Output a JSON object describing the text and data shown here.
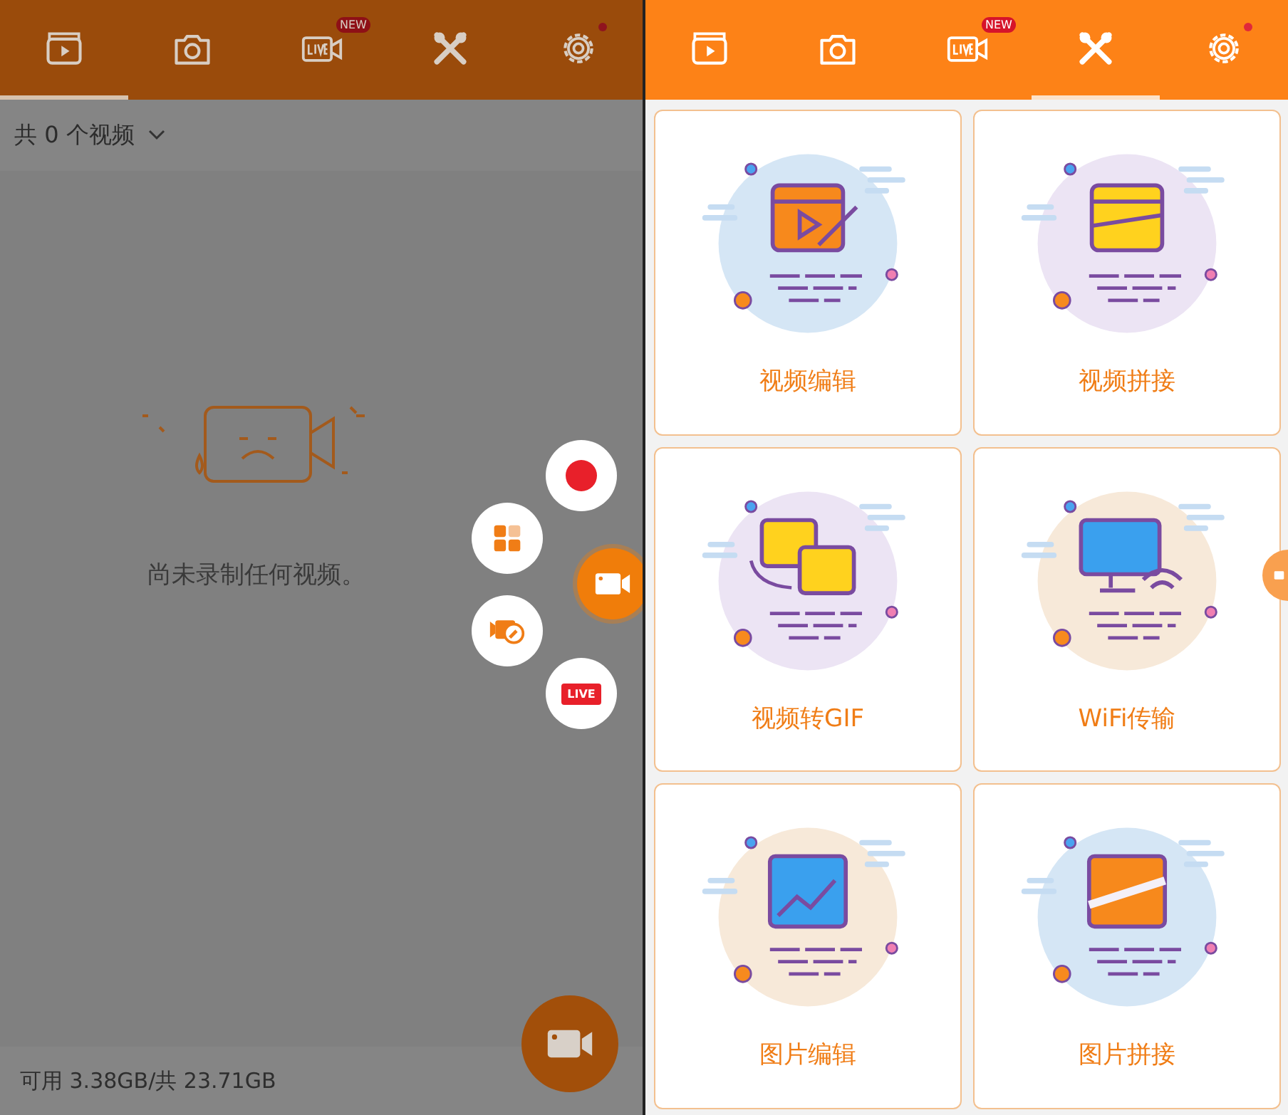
{
  "left": {
    "tabs": [
      {
        "kind": "video",
        "selected": true
      },
      {
        "kind": "camera",
        "selected": false
      },
      {
        "kind": "live",
        "selected": false,
        "badge": "NEW"
      },
      {
        "kind": "tools",
        "selected": false
      },
      {
        "kind": "settings",
        "selected": false,
        "notify": true
      }
    ],
    "video_count": "共 0 个视频",
    "empty_text": "尚未录制任何视频。",
    "fab_menu": [
      {
        "kind": "record"
      },
      {
        "kind": "apps"
      },
      {
        "kind": "camera"
      },
      {
        "kind": "tool"
      },
      {
        "kind": "live",
        "label": "LIVE"
      }
    ],
    "storage": "可用 3.38GB/共 23.71GB"
  },
  "right": {
    "tabs": [
      {
        "kind": "video",
        "selected": false
      },
      {
        "kind": "camera",
        "selected": false
      },
      {
        "kind": "live",
        "selected": false,
        "badge": "NEW"
      },
      {
        "kind": "tools",
        "selected": true
      },
      {
        "kind": "settings",
        "selected": false,
        "notify": true
      }
    ],
    "tools": [
      {
        "label": "视频编辑",
        "kind": "edit",
        "color": "#d5e6f5"
      },
      {
        "label": "视频拼接",
        "kind": "merge",
        "color": "#ece4f4"
      },
      {
        "label": "视频转GIF",
        "kind": "gif",
        "color": "#ece4f4"
      },
      {
        "label": "WiFi传输",
        "kind": "wifi",
        "color": "#f7e9d9"
      },
      {
        "label": "图片编辑",
        "kind": "image",
        "color": "#f7e9d9"
      },
      {
        "label": "图片拼接",
        "kind": "collage",
        "color": "#d5e6f5"
      }
    ]
  }
}
